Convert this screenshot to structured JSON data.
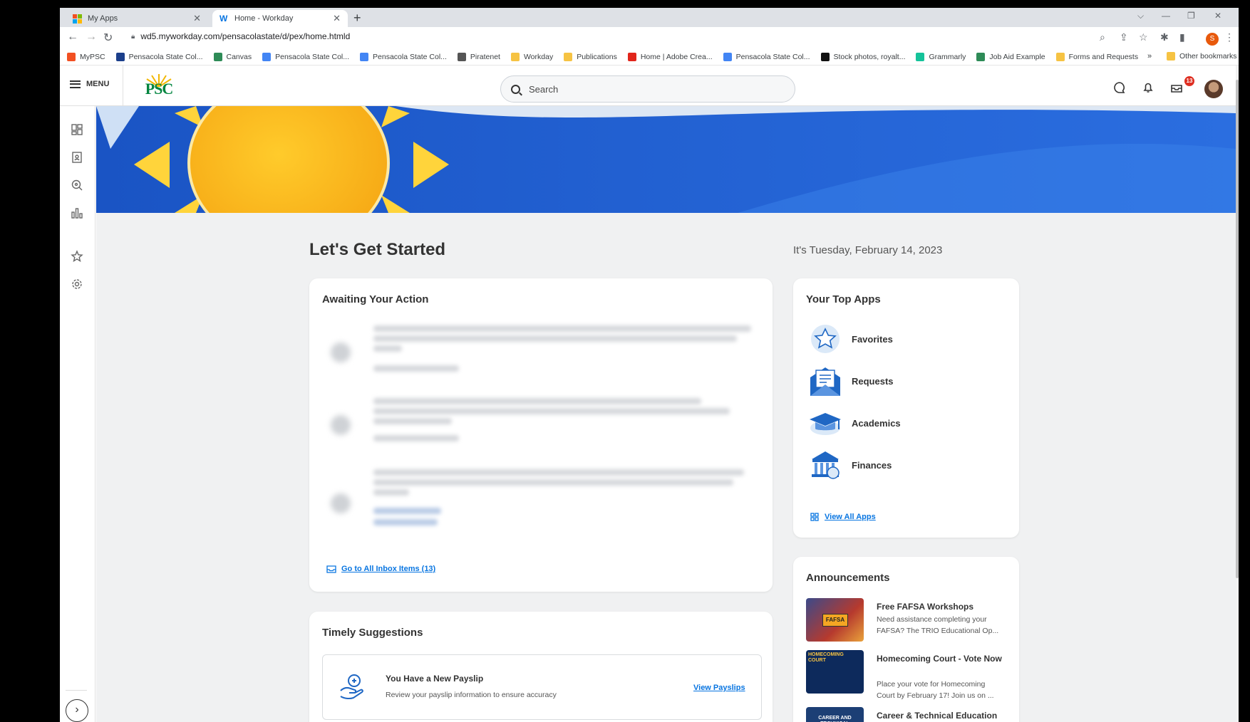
{
  "browser": {
    "tabs": [
      {
        "label": "My Apps"
      },
      {
        "label": "Home - Workday"
      }
    ],
    "url": "wd5.myworkday.com/pensacolastate/d/pex/home.htmld",
    "profile_initial": "S",
    "bookmarks": [
      {
        "label": "MyPSC",
        "color": "#f25022"
      },
      {
        "label": "Pensacola State Col...",
        "color": "#1b3f8b"
      },
      {
        "label": "Canvas",
        "color": "#2e8b57"
      },
      {
        "label": "Pensacola State Col...",
        "color": "#4285f4"
      },
      {
        "label": "Pensacola State Col...",
        "color": "#4285f4"
      },
      {
        "label": "Piratenet",
        "color": "#555555"
      },
      {
        "label": "Workday",
        "color": "#f6c343"
      },
      {
        "label": "Publications",
        "color": "#f6c343"
      },
      {
        "label": "Home | Adobe Crea...",
        "color": "#e1251b"
      },
      {
        "label": "Pensacola State Col...",
        "color": "#4285f4"
      },
      {
        "label": "Stock photos, royalt...",
        "color": "#111111"
      },
      {
        "label": "Grammarly",
        "color": "#15c39a"
      },
      {
        "label": "Job Aid Example",
        "color": "#2e8b57"
      },
      {
        "label": "Forms and Requests",
        "color": "#f6c343"
      }
    ],
    "bookmarks_more": "»",
    "other_bookmarks": "Other bookmarks"
  },
  "header": {
    "menu_label": "MENU",
    "logo_text": "PSC",
    "search_placeholder": "Search",
    "inbox_badge": "13"
  },
  "main": {
    "title": "Let's Get Started",
    "date": "It's Tuesday, February 14, 2023",
    "awaiting": {
      "title": "Awaiting Your Action",
      "link": "Go to All Inbox Items (13)"
    },
    "top_apps": {
      "title": "Your Top Apps",
      "items": [
        {
          "label": "Favorites",
          "icon": "favorites-icon"
        },
        {
          "label": "Requests",
          "icon": "requests-icon"
        },
        {
          "label": "Academics",
          "icon": "academics-icon"
        },
        {
          "label": "Finances",
          "icon": "finances-icon"
        }
      ],
      "view_all": "View All Apps"
    },
    "announcements": {
      "title": "Announcements",
      "items": [
        {
          "title": "Free FAFSA Workshops",
          "desc": "Need assistance completing your FAFSA? The TRIO Educational Op...",
          "thumb_text": "FAFSA"
        },
        {
          "title": "Homecoming Court - Vote Now",
          "desc": "Place your vote for Homecoming Court by February 17! Join us on ...",
          "thumb_text": "HOMECOMING COURT"
        },
        {
          "title": "Career & Technical Education Month",
          "desc": "",
          "thumb_text": "CAREER AND TECHNICAL EDUCATION"
        }
      ]
    },
    "suggestions": {
      "title": "Timely Suggestions",
      "item_title": "You Have a New Payslip",
      "item_desc": "Review your payslip information to ensure accuracy",
      "item_link": "View Payslips"
    }
  },
  "colors": {
    "accent": "#0875e1",
    "brand_green": "#00853f",
    "banner_blue": "#1e5bc6",
    "sun_yellow": "#f9c623"
  }
}
